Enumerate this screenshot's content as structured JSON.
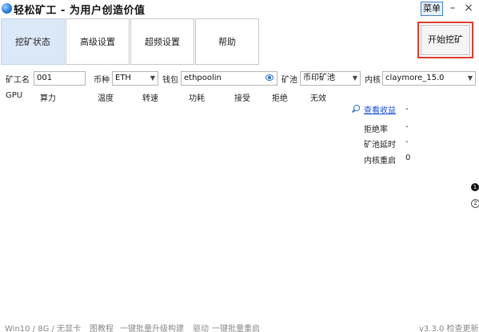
{
  "window": {
    "title": "轻松矿工 - 为用户创造价值",
    "menu_label": "菜单",
    "minimize_glyph": "–",
    "close_glyph": "×"
  },
  "tabs": [
    {
      "label": "挖矿状态",
      "active": true
    },
    {
      "label": "高级设置",
      "active": false
    },
    {
      "label": "超频设置",
      "active": false
    },
    {
      "label": "帮助",
      "active": false
    }
  ],
  "start_button": {
    "label": "开始挖矿"
  },
  "config": {
    "worker_label": "矿工名",
    "worker_value": "001",
    "coin_label": "币种",
    "coin_value": "ETH",
    "wallet_label": "钱包",
    "wallet_value": "ethpoolin",
    "pool_label": "矿池",
    "pool_value": "币印矿池",
    "kernel_label": "内核",
    "kernel_value": "claymore_15.0"
  },
  "table": {
    "headers": [
      "GPU",
      "算力",
      "温度",
      "转速",
      "功耗",
      "接受",
      "拒绝",
      "无效"
    ]
  },
  "stats": {
    "income_link": "查看收益",
    "income_value": "-",
    "rows": [
      {
        "label": "拒绝率",
        "value": "-"
      },
      {
        "label": "矿池延时",
        "value": "-"
      },
      {
        "label": "内核重启",
        "value": "0"
      }
    ]
  },
  "side_tabs": [
    "1",
    "2"
  ],
  "status": {
    "left": "Win10 / 8G / 无显卡",
    "items": [
      "图教程",
      "一键批量升级构建",
      "驱动",
      "一键批量重启"
    ],
    "version": "v3.3.0 检查更新"
  }
}
